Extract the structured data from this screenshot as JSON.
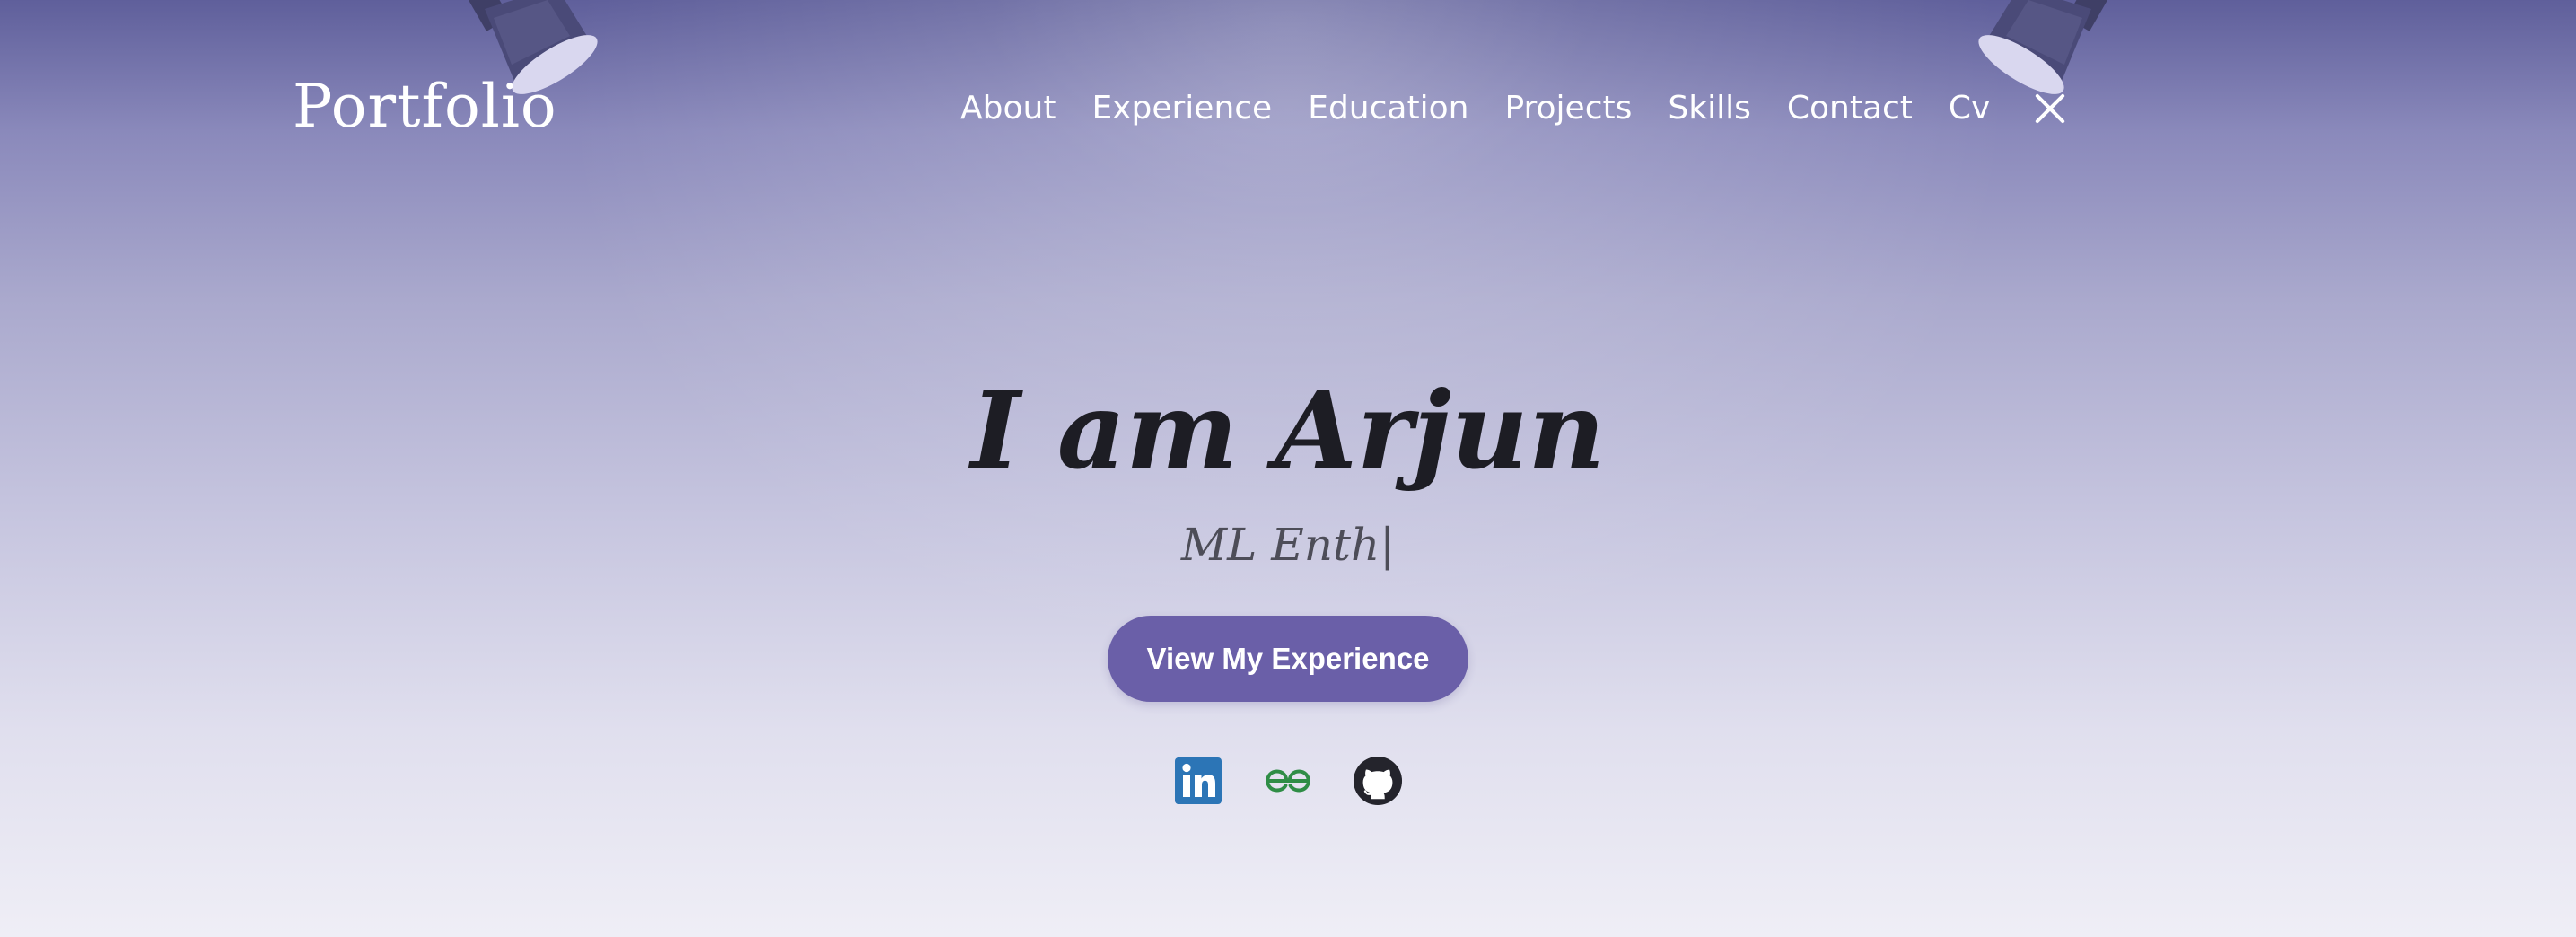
{
  "nav": {
    "logo": "Portfolio",
    "links": [
      "About",
      "Experience",
      "Education",
      "Projects",
      "Skills",
      "Contact",
      "Cv"
    ]
  },
  "hero": {
    "title": "I am Arjun",
    "subtitle": "ML Enth",
    "button": "View My Experience"
  },
  "icons": {
    "menu_close": "close-icon",
    "socials": [
      "linkedin-icon",
      "geeksforgeeks-icon",
      "github-icon"
    ]
  },
  "colors": {
    "accent": "#6a5fa8",
    "linkedin": "#2c75b6",
    "gfg": "#2f8d46",
    "github": "#24242c"
  }
}
